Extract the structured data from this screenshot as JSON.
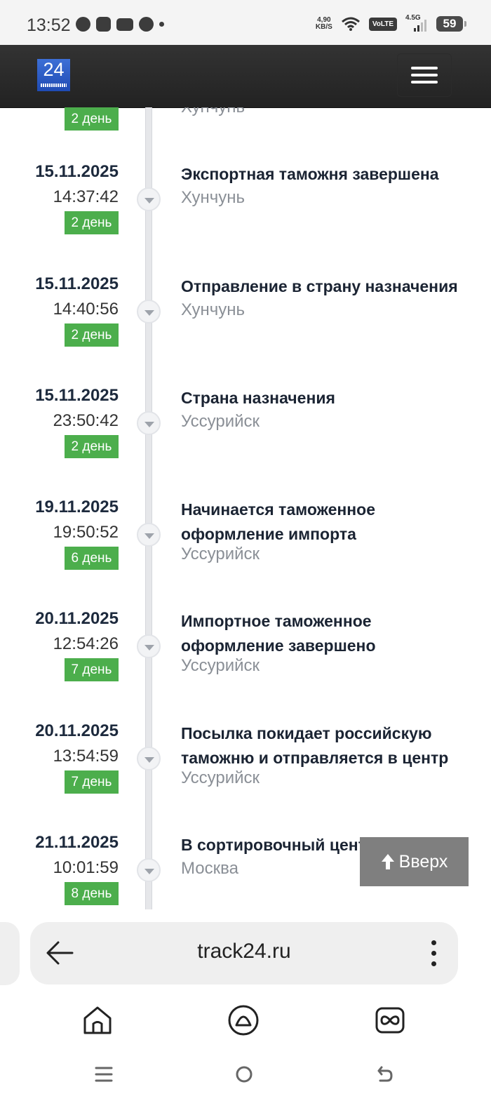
{
  "status_bar": {
    "time": "13:52",
    "net_speed_top": "4,90",
    "net_speed_bottom": "KB/S",
    "volte": "VoLTE",
    "signal": "4.5G",
    "battery": "59"
  },
  "header": {
    "logo_text": "24"
  },
  "partial_top_event": {
    "badge": "2 день",
    "place": "Хунчунь"
  },
  "events": [
    {
      "date": "15.11.2025",
      "time": "14:37:42",
      "badge": "2 день",
      "status": "Экспортная таможня завершена",
      "place": "Хунчунь"
    },
    {
      "date": "15.11.2025",
      "time": "14:40:56",
      "badge": "2 день",
      "status": "Отправление в страну назначения",
      "place": "Хунчунь"
    },
    {
      "date": "15.11.2025",
      "time": "23:50:42",
      "badge": "2 день",
      "status": "Страна назначения",
      "place": "Уссурийск"
    },
    {
      "date": "19.11.2025",
      "time": "19:50:52",
      "badge": "6 день",
      "status": "Начинается таможенное оформление импорта",
      "place": "Уссурийск"
    },
    {
      "date": "20.11.2025",
      "time": "12:54:26",
      "badge": "7 день",
      "status": "Импортное таможенное оформление завершено",
      "place": "Уссурийск"
    },
    {
      "date": "20.11.2025",
      "time": "13:54:59",
      "badge": "7 день",
      "status": "Посылка покидает российскую таможню и отправляется в центр",
      "place": "Уссурийск"
    },
    {
      "date": "21.11.2025",
      "time": "10:01:59",
      "badge": "8 день",
      "status": "В сортировочный центр",
      "place": "Москва"
    }
  ],
  "scroll_top": {
    "label": "Вверх"
  },
  "browser": {
    "url": "track24.ru"
  }
}
